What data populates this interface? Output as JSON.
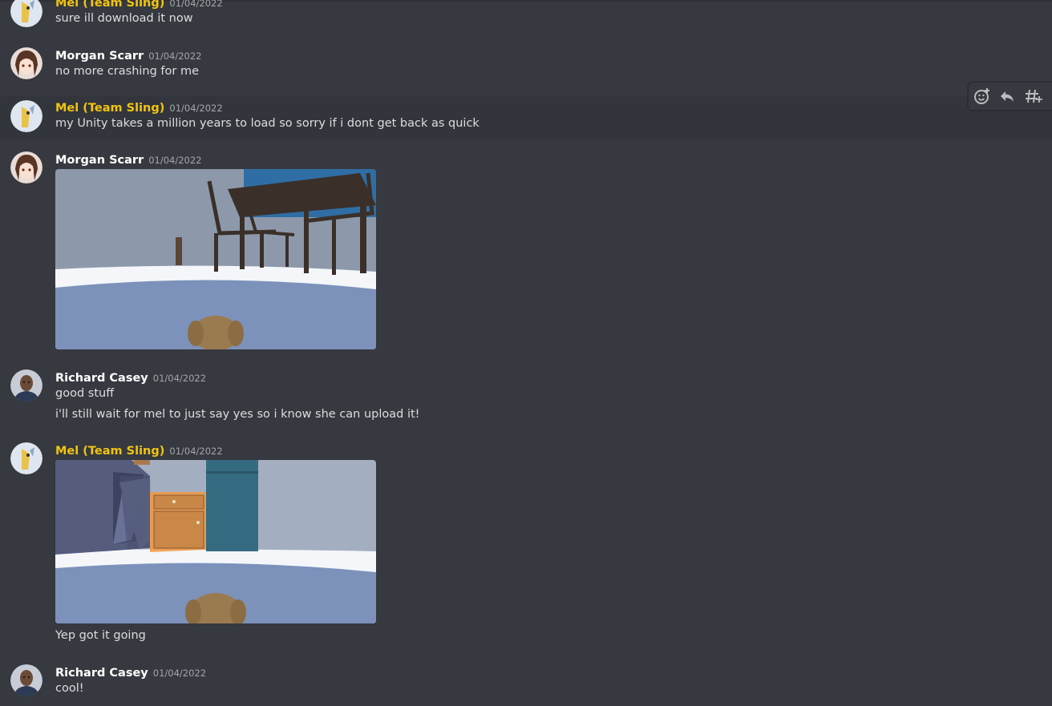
{
  "messages": [
    {
      "author": "Mel (Team Sling)",
      "timestamp": "01/04/2022",
      "lines": [
        "sure ill download it now"
      ]
    },
    {
      "author": "Morgan Scarr",
      "timestamp": "01/04/2022",
      "lines": [
        "no more crashing for me"
      ]
    },
    {
      "author": "Mel (Team Sling)",
      "timestamp": "01/04/2022",
      "lines": [
        "my Unity takes a million years to load so sorry if i dont get back as quick"
      ]
    },
    {
      "author": "Morgan Scarr",
      "timestamp": "01/04/2022",
      "lines": []
    },
    {
      "author": "Richard Casey",
      "timestamp": "01/04/2022",
      "lines": [
        "good stuff",
        "i'll still wait for mel to just say yes so i know she can upload it!"
      ]
    },
    {
      "author": "Mel (Team Sling)",
      "timestamp": "01/04/2022",
      "lines": [
        "Yep got it going"
      ]
    },
    {
      "author": "Richard Casey",
      "timestamp": "01/04/2022",
      "lines": [
        "cool!"
      ]
    }
  ],
  "toolbar": {
    "icons": [
      "add-reaction-icon",
      "reply-icon",
      "create-thread-icon"
    ]
  },
  "colors": {
    "background": "#36393f",
    "hover_background": "#32353b",
    "author_default": "#ffffff",
    "author_role": "#f1c40f",
    "text": "#dcddde",
    "timestamp": "#a3a6aa"
  }
}
